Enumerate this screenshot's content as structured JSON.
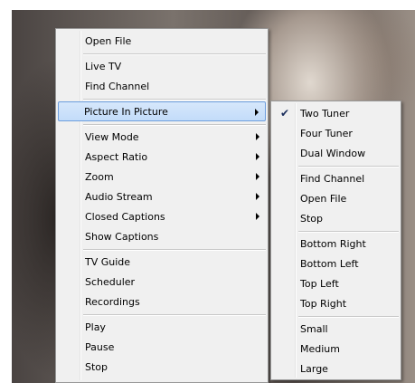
{
  "main_menu": {
    "items": [
      {
        "label": "Open File"
      },
      {
        "label": "Live TV"
      },
      {
        "label": "Find Channel"
      },
      {
        "label": "Picture In Picture"
      },
      {
        "label": "View Mode"
      },
      {
        "label": "Aspect Ratio"
      },
      {
        "label": "Zoom"
      },
      {
        "label": "Audio Stream"
      },
      {
        "label": "Closed Captions"
      },
      {
        "label": "Show Captions"
      },
      {
        "label": "TV Guide"
      },
      {
        "label": "Scheduler"
      },
      {
        "label": "Recordings"
      },
      {
        "label": "Play"
      },
      {
        "label": "Pause"
      },
      {
        "label": "Stop"
      }
    ]
  },
  "sub_menu": {
    "checked_index": 0,
    "items": [
      {
        "label": "Two Tuner"
      },
      {
        "label": "Four Tuner"
      },
      {
        "label": "Dual Window"
      },
      {
        "label": "Find Channel"
      },
      {
        "label": "Open File"
      },
      {
        "label": "Stop"
      },
      {
        "label": "Bottom Right"
      },
      {
        "label": "Bottom Left"
      },
      {
        "label": "Top Left"
      },
      {
        "label": "Top Right"
      },
      {
        "label": "Small"
      },
      {
        "label": "Medium"
      },
      {
        "label": "Large"
      }
    ]
  },
  "colors": {
    "menu_bg": "#f0f0f0",
    "highlight_border": "#6d9ede",
    "highlight_fill": "#c3dcf9"
  },
  "icons": {
    "check": "check-icon",
    "submenu_arrow": "chevron-right-icon"
  }
}
